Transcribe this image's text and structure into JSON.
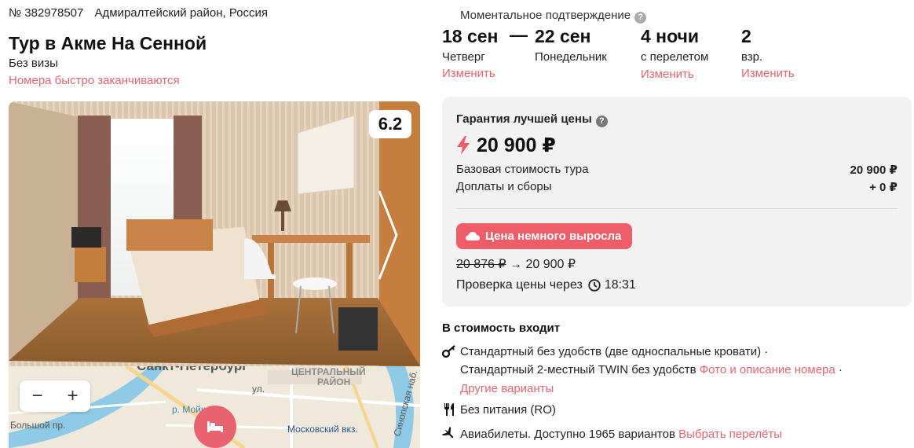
{
  "header": {
    "tour_number": "№ 382978507",
    "location": "Адмиралтейский район, Россия",
    "title": "Тур в Акме На Сенной",
    "visa": "Без визы",
    "warning": "Номера быстро заканчиваются"
  },
  "photo": {
    "rating": "6.2"
  },
  "map": {
    "zoom_out": "−",
    "zoom_in": "+",
    "labels": {
      "district": "ЦЕНТРАЛЬНЫЙ",
      "district2": "РАЙОН",
      "river": "р. Мойка",
      "station": "Московский вкз.",
      "embankment": "Синопская наб.",
      "prospect": "Большой пр.",
      "ul1": "ул.",
      "city": "Санкт-Петербург"
    }
  },
  "booking": {
    "instant_confirmation": "Моментальное подтверждение",
    "date_from": "18 сен",
    "dash": "—",
    "date_to": "22 сен",
    "day_from": "Четверг",
    "day_to": "Понедельник",
    "nights": "4 ночи",
    "nights_sub": "с перелетом",
    "guests": "2",
    "guests_sub": "взр.",
    "change_label": "Изменить"
  },
  "price": {
    "guarantee": "Гарантия лучшей цены",
    "total": "20 900 ₽",
    "base_label": "Базовая стоимость тура",
    "base_value": "20 900 ₽",
    "fees_label": "Доплаты и сборы",
    "fees_value": "+ 0 ₽",
    "badge": "Цена немного выросла",
    "old_price": "20 876 ₽",
    "arrow": "→",
    "new_price": "20 900 ₽",
    "recheck_label": "Проверка цены через",
    "recheck_time": "18:31"
  },
  "includes": {
    "title": "В стоимость входит",
    "room_line1": "Стандартный без удобств (две односпальные кровати) ·",
    "room_line2": "Стандартный 2-местный TWIN без удобств",
    "room_photos_link": "Фото и описание номера",
    "sep": "·",
    "other_options_link": "Другие варианты",
    "meal": "Без питания (RO)",
    "flights": "Авиабилеты. Доступно 1965 вариантов",
    "flights_link": "Выбрать перелёты"
  },
  "colors": {
    "accent": "#e8636f",
    "badge": "#ee5d68",
    "card_bg": "#f2f2f2"
  },
  "icons": {
    "help": "question-circle-icon",
    "lightning": "lightning-icon",
    "badge": "cloud-up-icon",
    "clock": "clock-icon",
    "key": "key-icon",
    "meal": "fork-knife-icon",
    "plane": "plane-icon",
    "next": "chevron-right-icon",
    "bed": "bed-icon"
  }
}
